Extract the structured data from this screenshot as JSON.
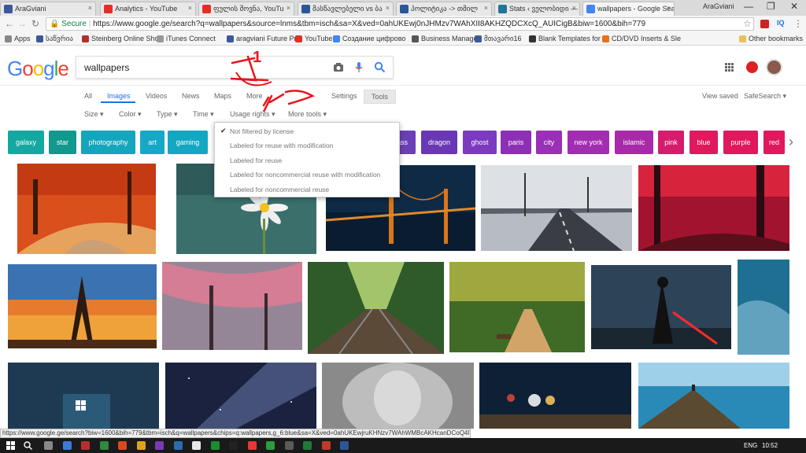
{
  "tabs": [
    {
      "label": "AraGviani",
      "color": "#3b5998"
    },
    {
      "label": "Analytics - YouTube",
      "color": "#e52d27"
    },
    {
      "label": "ფულის შოვნა, YouTu",
      "color": "#e52d27"
    },
    {
      "label": "მასწავლებელი vs ბა",
      "color": "#2b579a"
    },
    {
      "label": "პოლიტიკა -> თმილ",
      "color": "#2b579a"
    },
    {
      "label": "Stats ‹ ველობიდი —",
      "color": "#21759b"
    },
    {
      "label": "wallpapers - Google Sea",
      "color": "#4285f4",
      "active": true
    }
  ],
  "window": {
    "user": "AraGviani",
    "minimize": "—",
    "restore": "❐",
    "close": "✕"
  },
  "address": {
    "secure": "Secure",
    "url": "https://www.google.ge/search?q=wallpapers&source=lnms&tbm=isch&sa=X&ved=0ahUKEwj0nJHMzv7WAhXII8AKHZQDCXcQ_AUICigB&biw=1600&bih=779"
  },
  "bookmarks": [
    {
      "label": "Apps",
      "color": "#888"
    },
    {
      "label": "საწვრია",
      "color": "#3b5998"
    },
    {
      "label": "Steinberg Online Sho",
      "color": "#b0302d"
    },
    {
      "label": "iTunes Connect",
      "color": "#999"
    },
    {
      "label": "aragviani Future Proj",
      "color": "#3b5998"
    },
    {
      "label": "YouTube",
      "color": "#e52d27"
    },
    {
      "label": "Создание цифрово",
      "color": "#4285f4"
    },
    {
      "label": "Business Manager",
      "color": "#555"
    },
    {
      "label": "მთავარი16",
      "color": "#3b5998"
    },
    {
      "label": "Blank Templates for M",
      "color": "#333"
    },
    {
      "label": "CD/DVD Inserts & Sle",
      "color": "#e8711c"
    },
    {
      "label": "Other bookmarks",
      "color": "#e8c15a"
    }
  ],
  "search": {
    "query": "wallpapers"
  },
  "nav": {
    "all": "All",
    "images": "Images",
    "videos": "Videos",
    "news": "News",
    "maps": "Maps",
    "more": "More",
    "settings": "Settings",
    "tools": "Tools",
    "view_saved": "View saved",
    "safesearch": "SafeSearch"
  },
  "tools": {
    "size": "Size",
    "color": "Color",
    "type": "Type",
    "time": "Time",
    "usage": "Usage rights",
    "more_tools": "More tools"
  },
  "usage_rights_menu": [
    "Not filtered by license",
    "Labeled for reuse with modification",
    "Labeled for reuse",
    "Labeled for noncommercial reuse with modification",
    "Labeled for noncommercial reuse"
  ],
  "chips": [
    {
      "label": "galaxy",
      "color": "#14a8a0"
    },
    {
      "label": "star",
      "color": "#11998e"
    },
    {
      "label": "photography",
      "color": "#13a6bd"
    },
    {
      "label": "art",
      "color": "#15a8c7"
    },
    {
      "label": "gaming",
      "color": "#14a7c1"
    },
    {
      "label": "ass",
      "color": "#6b3fb5"
    },
    {
      "label": "dragon",
      "color": "#6a38b5"
    },
    {
      "label": "ghost",
      "color": "#7b3ac0"
    },
    {
      "label": "paris",
      "color": "#8e30b5"
    },
    {
      "label": "city",
      "color": "#9a2fb8"
    },
    {
      "label": "new york",
      "color": "#a32db2"
    },
    {
      "label": "islamic",
      "color": "#a82aa8"
    },
    {
      "label": "pink",
      "color": "#d51c6d"
    },
    {
      "label": "blue",
      "color": "#e0185e"
    },
    {
      "label": "purple",
      "color": "#e0185e"
    },
    {
      "label": "red",
      "color": "#e0185e"
    }
  ],
  "annotation": {
    "text": "1"
  },
  "status": {
    "url": "https://www.google.ge/search?biw=1600&bih=779&tbm=isch&q=wallpapers&chips=q:wallpapers,g_6:blue&sa=X&ved=0ahUKEwjruKHNzv7WAhWMBcAKHcanDCoQ4lYIPigB"
  },
  "taskbar": {
    "lang": "ENG",
    "time": "10:52"
  },
  "colors": {
    "google_blue": "#4285f4",
    "google_red": "#ea4335",
    "google_yellow": "#fbbc05",
    "google_green": "#34a853",
    "annotation_red": "#e8151b"
  }
}
